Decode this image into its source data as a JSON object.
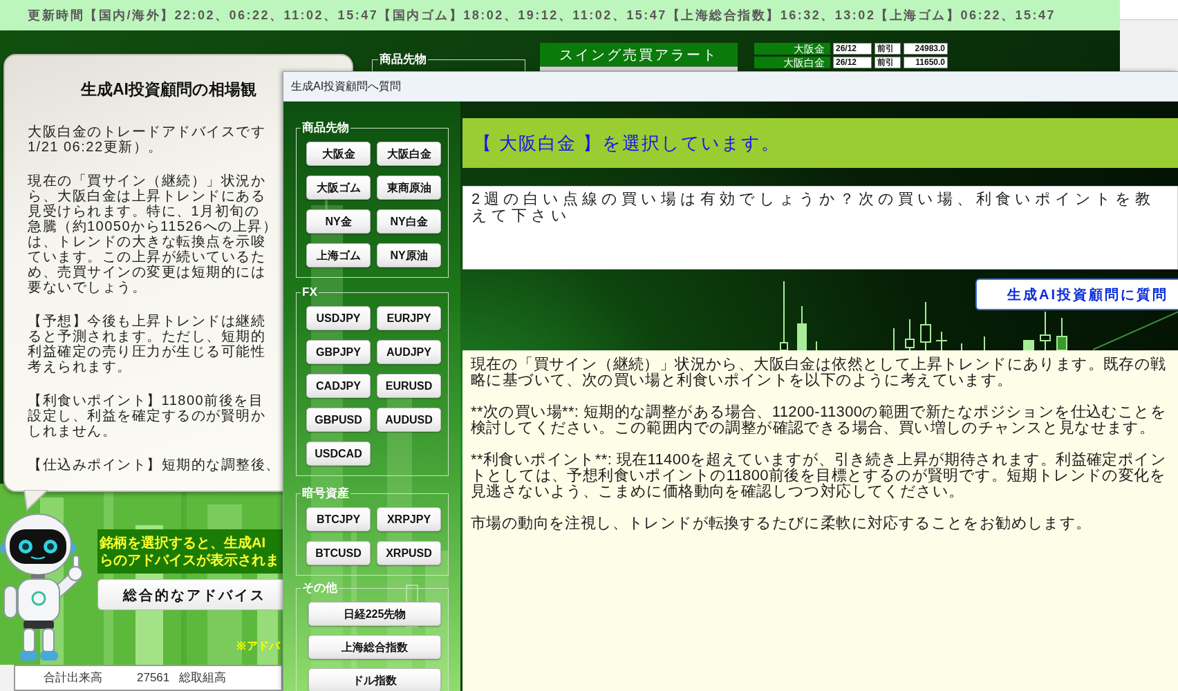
{
  "update_bar": {
    "text": "更新時間【国内/海外】22:02、06:22、11:02、15:47【国内ゴム】18:02、19:12、11:02、15:47【上海総合指数】16:32、13:02【上海ゴム】06:22、15:47"
  },
  "market_view": {
    "title": "生成AI投資顧問の相場観",
    "paragraphs": [
      {
        "lines": [
          "大阪白金のトレードアドバイスです",
          "1/21 06:22更新）。"
        ]
      },
      {
        "lines": [
          "現在の「買サイン（継続）」状況か",
          "ら、大阪白金は上昇トレンドにある",
          "見受けられます。特に、1月初旬の",
          "急騰（約10050から11526への上昇）",
          "は、トレンドの大きな転換点を示唆",
          "ています。この上昇が続いているた",
          "め、売買サインの変更は短期的には",
          "要ないでしょう。"
        ]
      },
      {
        "lines": [
          "【予想】今後も上昇トレンドは継続",
          "ると予測されます。ただし、短期的",
          "利益確定の売り圧力が生じる可能性",
          "考えられます。"
        ]
      },
      {
        "lines": [
          "【利食いポイント】11800前後を目",
          "設定し、利益を確定するのが賢明か",
          "しれません。"
        ]
      },
      {
        "lines": [
          "【仕込みポイント】短期的な調整後、"
        ]
      }
    ]
  },
  "hint_banner": {
    "lines": [
      "銘柄を選択すると、生成AI",
      "らのアドバイスが表示されま"
    ]
  },
  "overall_advice_button": {
    "label": "総合的なアドバイス"
  },
  "footnote": "※アドバ",
  "volume_bar": {
    "items": [
      "合計出来高",
      "27561",
      "総取組高"
    ]
  },
  "commodities_frame": {
    "legend": "商品先物"
  },
  "alert_button": {
    "label": "スイング売買アラート"
  },
  "price_rows": [
    {
      "name": "大阪金",
      "contract": "26/12",
      "session": "前引",
      "price": "24983.0"
    },
    {
      "name": "大阪白金",
      "contract": "26/12",
      "session": "前引",
      "price": "11650.0"
    }
  ],
  "dialog": {
    "title": "生成AI投資顧問へ質問",
    "groups": [
      {
        "legend": "商品先物",
        "kind": "grid",
        "buttons": [
          "大阪金",
          "大阪白金",
          "大阪ゴム",
          "東商原油",
          "NY金",
          "NY白金",
          "上海ゴム",
          "NY原油"
        ]
      },
      {
        "legend": "FX",
        "kind": "grid",
        "buttons": [
          "USDJPY",
          "EURJPY",
          "GBPJPY",
          "AUDJPY",
          "CADJPY",
          "EURUSD",
          "GBPUSD",
          "AUDUSD",
          "USDCAD"
        ]
      },
      {
        "legend": "暗号資産",
        "kind": "grid",
        "buttons": [
          "BTCJPY",
          "XRPJPY",
          "BTCUSD",
          "XRPUSD"
        ]
      },
      {
        "legend": "その他",
        "kind": "list",
        "buttons": [
          "日経225先物",
          "上海総合指数",
          "ドル指数"
        ]
      }
    ],
    "selection_banner": "【 大阪白金 】を選択しています。",
    "question": {
      "value": "2週の白い点線の買い場は有効でしょうか？次の買い場、利食いポイントを教えて下さい"
    },
    "ask_button": {
      "label": "生成AI投資顧問に質問"
    },
    "answer": {
      "paragraphs": [
        "現在の「買サイン（継続）」状況から、大阪白金は依然として上昇トレンドにあります。既存の戦略に基づいて、次の買い場と利食いポイントを以下のように考えています。",
        "**次の買い場**: 短期的な調整がある場合、11200-11300の範囲で新たなポジションを仕込むことを検討してください。この範囲内での調整が確認できる場合、買い増しのチャンスと見なせます。",
        "**利食いポイント**: 現在11400を超えていますが、引き続き上昇が期待されます。利益確定ポイントとしては、予想利食いポイントの11800前後を目標とするのが賢明です。短期トレンドの変化を見逃さないよう、こまめに価格動向を確認しつつ対応してください。",
        "市場の動向を注視し、トレンドが転換するたびに柔軟に対応することをお勧めします。"
      ]
    }
  }
}
